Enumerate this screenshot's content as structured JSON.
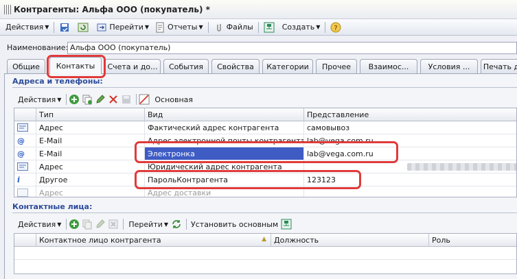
{
  "window": {
    "title": "Контрагенты: Альфа ООО (покупатель) *"
  },
  "toolbar": {
    "actions": "Действия",
    "goto": "Перейти",
    "reports": "Отчеты",
    "files": "Файлы",
    "create": "Создать"
  },
  "name": {
    "label": "Наименование:",
    "value": "Альфа ООО (покупатель)"
  },
  "tabs": [
    "Общие",
    "Контакты",
    "Счета и до...",
    "События",
    "Свойства",
    "Категории",
    "Прочее",
    "Взаимос...",
    "Условия ...",
    "Печать д"
  ],
  "addresses": {
    "title": "Адреса и телефоны:",
    "actions": "Действия",
    "main_label": "Основная",
    "columns": [
      "Тип",
      "Вид",
      "Представление"
    ],
    "rows": [
      {
        "icon": "address-card-icon",
        "type": "Адрес",
        "kind": "Фактический адрес контрагента",
        "repr": "самовывоз"
      },
      {
        "icon": "email-at-icon",
        "type": "E-Mail",
        "kind": "Адрес электронной почты контрагента для ...",
        "repr": "lab@vega.com.ru"
      },
      {
        "icon": "email-at-icon",
        "type": "E-Mail",
        "kind": "Электронка",
        "repr": "lab@vega.com.ru"
      },
      {
        "icon": "address-card-icon",
        "type": "Адрес",
        "kind": "Юридический адрес контрагента",
        "repr": ""
      },
      {
        "icon": "info-icon",
        "type": "Другое",
        "kind": "ПарольКонтрагента",
        "repr": "123123"
      },
      {
        "icon": "address-card-icon",
        "type": "Адрес",
        "kind": "Адрес доставки",
        "repr": ""
      }
    ]
  },
  "contacts": {
    "title": "Контактные лица:",
    "actions": "Действия",
    "goto": "Перейти",
    "set_main": "Установить основным",
    "columns": [
      "Контактное лицо контрагента",
      "Должность",
      "Роль"
    ]
  },
  "colors": {
    "accent": "#3e5cc4",
    "highlight": "#e03a3a",
    "section_title": "#2b4b9a"
  }
}
